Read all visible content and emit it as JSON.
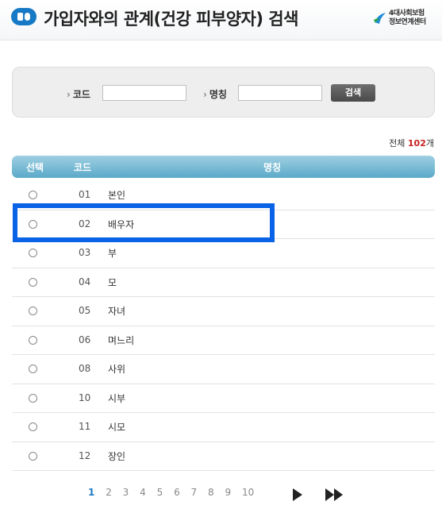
{
  "header": {
    "title": "가입자와의 관계(건강 피부양자) 검색",
    "logo_line1": "4대사회보험",
    "logo_line2": "정보연계센터"
  },
  "search": {
    "code_label": "코드",
    "name_label": "명칭",
    "code_value": "",
    "name_value": "",
    "button_label": "검색"
  },
  "summary": {
    "prefix": "전체",
    "count": "102",
    "suffix": "개"
  },
  "table": {
    "headers": [
      "선택",
      "코드",
      "명칭"
    ],
    "rows": [
      {
        "code": "01",
        "name": "본인"
      },
      {
        "code": "02",
        "name": "배우자"
      },
      {
        "code": "03",
        "name": "부"
      },
      {
        "code": "04",
        "name": "모"
      },
      {
        "code": "05",
        "name": "자녀"
      },
      {
        "code": "06",
        "name": "며느리"
      },
      {
        "code": "08",
        "name": "사위"
      },
      {
        "code": "10",
        "name": "시부"
      },
      {
        "code": "11",
        "name": "시모"
      },
      {
        "code": "12",
        "name": "장인"
      }
    ]
  },
  "pagination": {
    "pages": [
      "1",
      "2",
      "3",
      "4",
      "5",
      "6",
      "7",
      "8",
      "9",
      "10"
    ],
    "current": "1"
  },
  "colors": {
    "accent": "#1679c6",
    "table_header": "#5aa9c8",
    "count_highlight": "#c81e1e",
    "selection_box": "#0a62e6"
  }
}
